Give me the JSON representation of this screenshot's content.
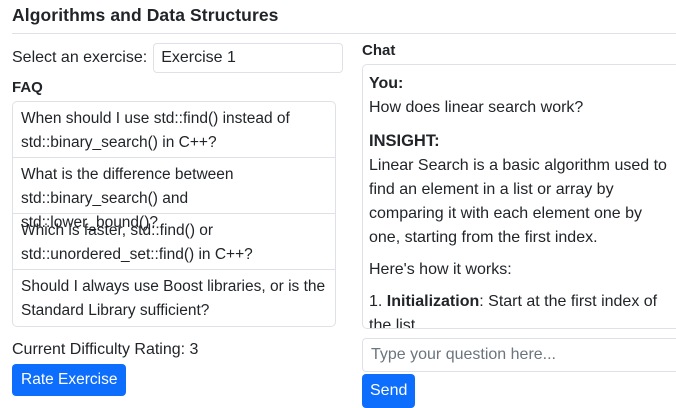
{
  "header": {
    "title": "Algorithms and Data Structures"
  },
  "exercise_select": {
    "label": "Select an exercise:",
    "value": "Exercise 1"
  },
  "faq": {
    "label": "FAQ",
    "items": [
      "When should I use std::find() instead of std::binary_search() in C++?",
      "What is the difference between std::binary_search() and std::lower_bound()?",
      "Which is faster, std::find() or std::unordered_set::find() in C++?",
      "Should I always use Boost libraries, or is the Standard Library sufficient?"
    ]
  },
  "difficulty": {
    "text": "Current Difficulty Rating: 3"
  },
  "rate_button": {
    "label": "Rate Exercise"
  },
  "chat": {
    "label": "Chat",
    "user_speaker": "You:",
    "user_message": "How does linear search work?",
    "assistant_speaker": "INSIGHT:",
    "assistant_paragraph": "Linear Search is a basic algorithm used to find an element in a list or array by comparing it with each element one by one, starting from the first index.",
    "assistant_intro": "Here's how it works:",
    "step1_number": "1.",
    "step1_title": "Initialization",
    "step1_text": ": Start at the first index of the list."
  },
  "input": {
    "placeholder": "Type your question here..."
  },
  "send_button": {
    "label": "Send"
  },
  "colors": {
    "primary": "#0d6efd",
    "border": "#dee2e6",
    "text": "#212529",
    "placeholder": "#6c757d"
  }
}
